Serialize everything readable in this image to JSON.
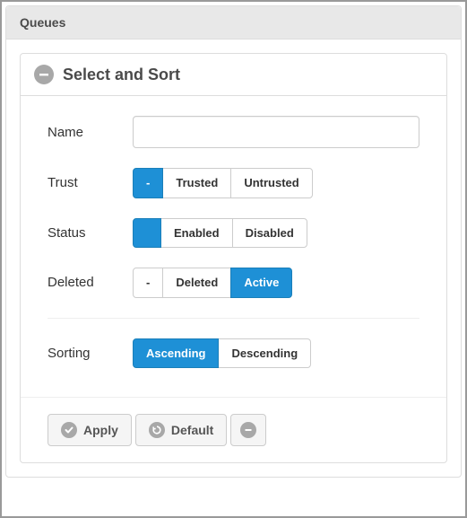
{
  "panel": {
    "title": "Queues"
  },
  "section": {
    "title": "Select and Sort"
  },
  "filters": {
    "name": {
      "label": "Name",
      "value": ""
    },
    "trust": {
      "label": "Trust",
      "options": {
        "dash": "-",
        "trusted": "Trusted",
        "untrusted": "Untrusted"
      },
      "active": "dash"
    },
    "status": {
      "label": "Status",
      "options": {
        "dash": "-",
        "enabled": "Enabled",
        "disabled": "Disabled"
      },
      "active": "dash"
    },
    "deleted": {
      "label": "Deleted",
      "options": {
        "dash": "-",
        "deleted": "Deleted",
        "active": "Active"
      },
      "active": "active"
    },
    "sorting": {
      "label": "Sorting",
      "options": {
        "asc": "Ascending",
        "desc": "Descending"
      },
      "active": "asc"
    }
  },
  "actions": {
    "apply": "Apply",
    "default": "Default"
  },
  "icons": {
    "collapse": "minus-icon",
    "apply": "check-icon",
    "default": "refresh-icon",
    "reset": "minus-icon"
  },
  "colors": {
    "primary": "#1e90d6",
    "panel_header": "#e8e8e8",
    "icon_gray": "#a8a8a8"
  }
}
